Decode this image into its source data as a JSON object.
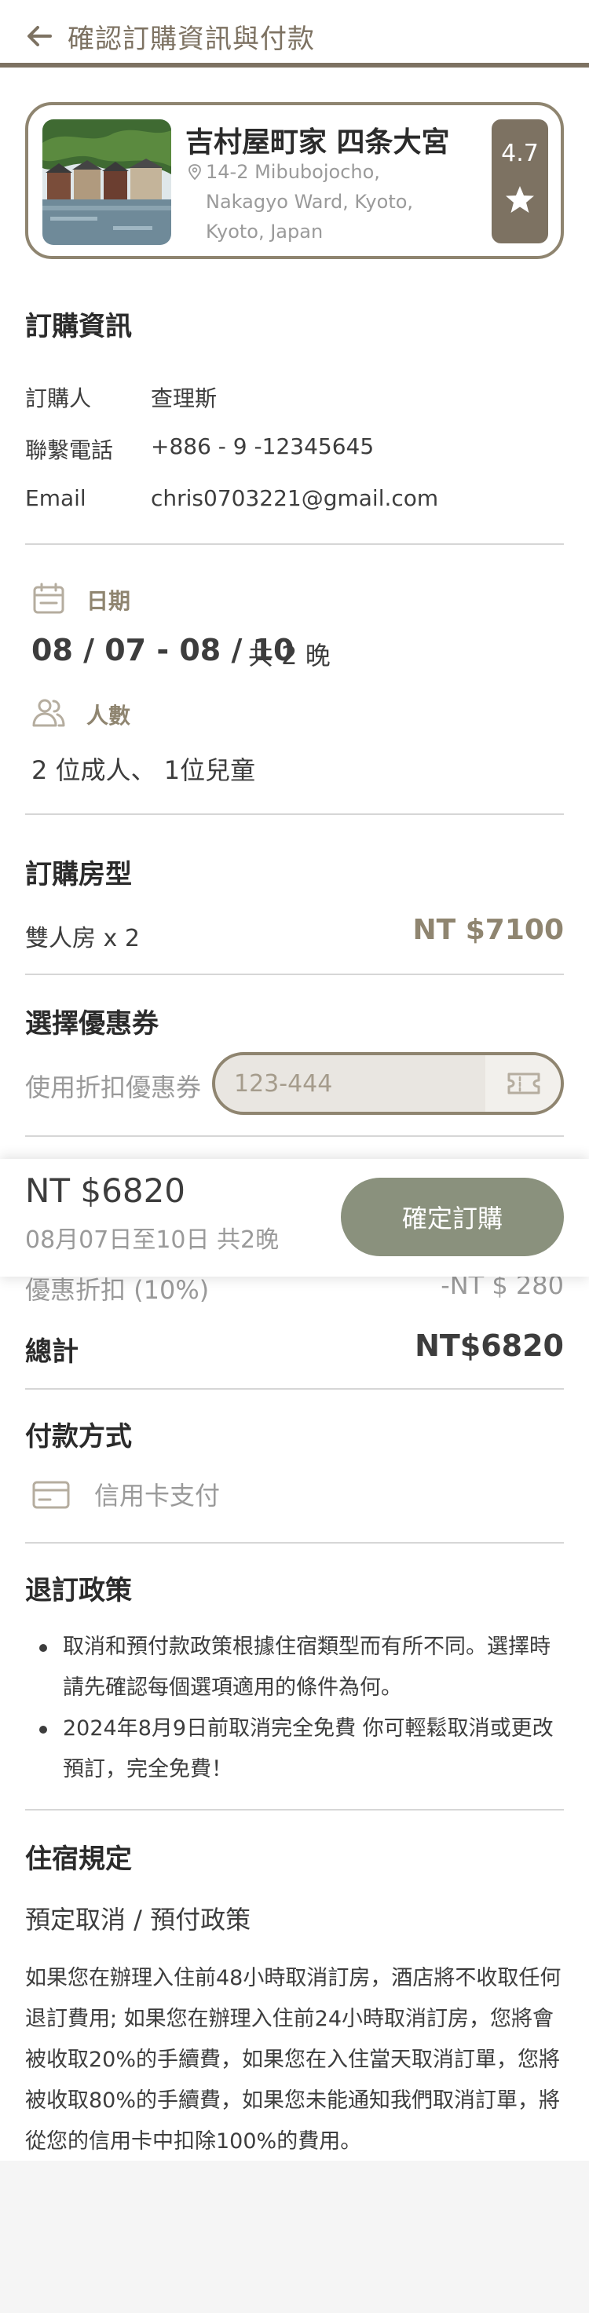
{
  "header": {
    "title": "確認訂購資訊與付款"
  },
  "hotel": {
    "name": "吉村屋町家 四条大宮",
    "address": "14-2 Mibubojocho, Nakagyo Ward, Kyoto, Kyoto, Japan",
    "rating": "4.7",
    "icons": {
      "location": "pin-icon",
      "rating": "star-icon"
    }
  },
  "order_info": {
    "title": "訂購資訊",
    "rows": [
      {
        "label": "訂購人",
        "value": "查理斯"
      },
      {
        "label": "聯繫電話",
        "value": "+886 - 9 -12345645"
      },
      {
        "label": "Email",
        "value": "chris0703221@gmail.com"
      }
    ]
  },
  "stay": {
    "date_label": "日期",
    "date_range": "08 / 07 - 08 / 10",
    "nights": "共 2 晚",
    "people_label": "人數",
    "people_value": "2 位成人、 1位兒童",
    "icons": {
      "date": "calendar-icon",
      "people": "people-icon"
    }
  },
  "room": {
    "title": "訂購房型",
    "type": "雙人房 x 2",
    "price": "NT $7100"
  },
  "coupon": {
    "title": "選擇優惠券",
    "label": "使用折扣優惠券",
    "value": "",
    "placeholder": "123-444",
    "icon": "ticket-icon"
  },
  "summary": {
    "discount_label": "優惠折扣 (10%)",
    "discount_value": "-NT $ 280",
    "total_label": "總計",
    "total_value": "NT$6820"
  },
  "payment": {
    "title": "付款方式",
    "method": "信用卡支付",
    "icon": "credit-card-icon"
  },
  "cancellation": {
    "title": "退訂政策",
    "items": [
      "取消和預付款政策根據住宿類型而有所不同。選擇時請先確認每個選項適用的條件為何。",
      "2024年8月9日前取消完全免費 你可輕鬆取消或更改預訂，完全免費！"
    ]
  },
  "rules": {
    "title": "住宿規定",
    "subtitle": "預定取消 / 預付政策",
    "body": "如果您在辦理入住前48小時取消訂房，酒店將不收取任何退訂費用; 如果您在辦理入住前24小時取消訂房，您將會被收取20%的手續費，如果您在入住當天取消訂單，您將被收取80%的手續費，如果您未能通知我們取消訂單，將從您的信用卡中扣除100%的費用。"
  },
  "bottom_bar": {
    "price": "NT $6820",
    "dates": "08月07日至10日 共2晚",
    "confirm_label": "確定訂購"
  },
  "colors": {
    "accent": "#7d7262",
    "accent_light": "#8f8570",
    "button": "#8a917d",
    "muted_text": "#9a9a9a",
    "divider": "#d6d6d6"
  }
}
